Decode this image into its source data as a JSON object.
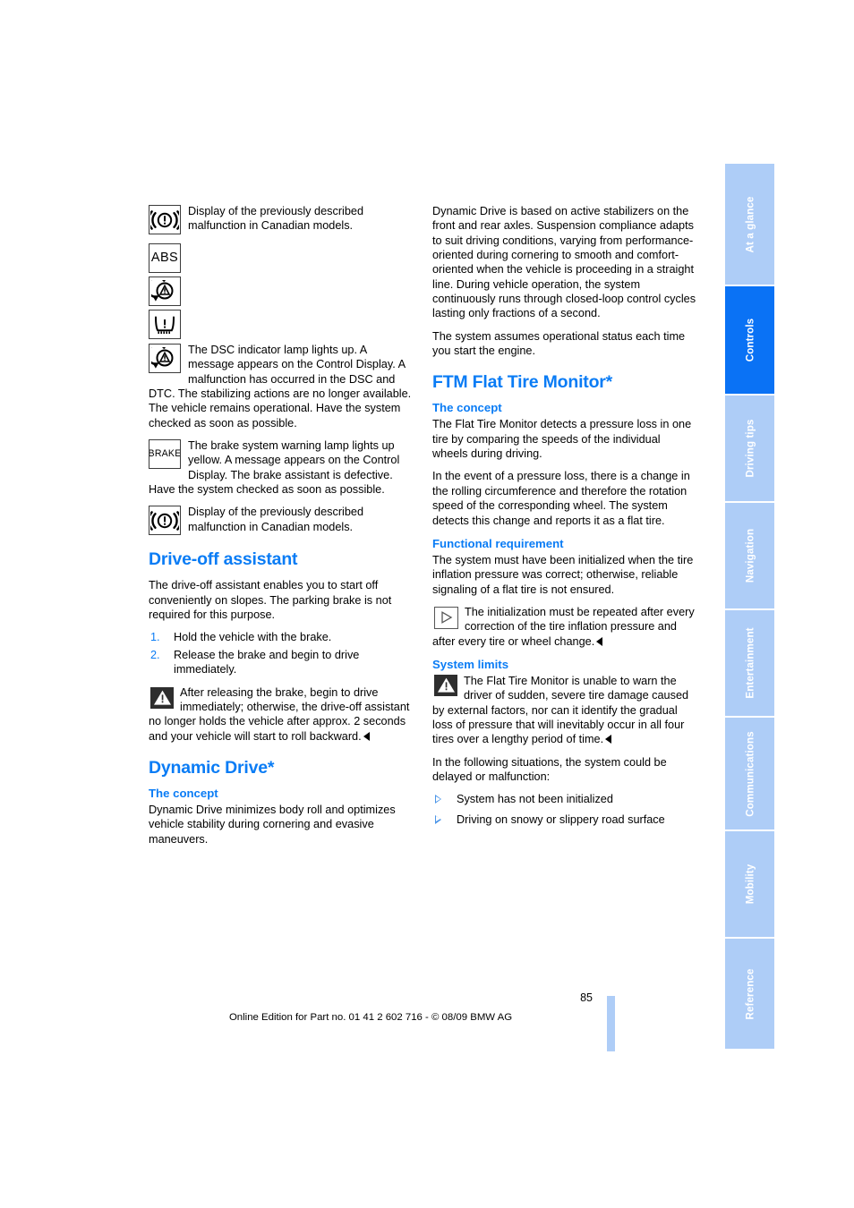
{
  "page": {
    "number": "85",
    "footer_text": "Online Edition for Part no. 01 41 2 602 716 - © 08/09 BMW AG",
    "accent_blue": "#0a7cf5",
    "tab_blue": "#aecdf7",
    "tab_active_blue": "#0a72f5"
  },
  "tabs": [
    {
      "label": "At a glance",
      "active": false
    },
    {
      "label": "Controls",
      "active": true
    },
    {
      "label": "Driving tips",
      "active": false
    },
    {
      "label": "Navigation",
      "active": false
    },
    {
      "label": "Entertainment",
      "active": false
    },
    {
      "label": "Communications",
      "active": false
    },
    {
      "label": "Mobility",
      "active": false
    },
    {
      "label": "Reference",
      "active": false
    }
  ],
  "left_column": {
    "canadian_display_top": "Display of the previously described malfunction in Canadian models.",
    "symbol_labels": {
      "brake_circle": "brake-warning-symbol",
      "abs": "ABS",
      "dsc": "dsc-symbol",
      "tire_pressure": "tire-pressure-symbol",
      "brake_word": "BRAKE"
    },
    "dsc_paragraph": "The DSC indicator lamp lights up. A message appears on the Control Display. A malfunction has occurred in the DSC and DTC. The stabilizing actions are no longer available. The vehicle remains operational. Have the system checked as soon as possible.",
    "brake_paragraph": "The brake system warning lamp lights up yellow. A message appears on the Control Display. The brake assistant is defective. Have the system checked as soon as possible.",
    "canadian_display_bottom": "Display of the previously described malfunction in Canadian models.",
    "drive_off": {
      "heading": "Drive-off assistant",
      "intro": "The drive-off assistant enables you to start off conveniently on slopes. The parking brake is not required for this purpose.",
      "steps": [
        {
          "num": "1.",
          "text": "Hold the vehicle with the brake."
        },
        {
          "num": "2.",
          "text": "Release the brake and begin to drive immediately."
        }
      ],
      "warning": "After releasing the brake, begin to drive immediately; otherwise, the drive-off assistant no longer holds the vehicle after approx. 2 seconds and your vehicle will start to roll backward."
    },
    "dynamic_drive": {
      "heading": "Dynamic Drive*",
      "subheading": "The concept",
      "body": "Dynamic Drive minimizes body roll and optimizes vehicle stability during cornering and evasive maneuvers."
    }
  },
  "right_column": {
    "dynamic_drive_cont_1": "Dynamic Drive is based on active stabilizers on the front and rear axles. Suspension compliance adapts to suit driving conditions, varying from performance-oriented during cornering to smooth and comfort-oriented when the vehicle is proceeding in a straight line. During vehicle operation, the system continuously runs through closed-loop control cycles lasting only fractions of a second.",
    "dynamic_drive_cont_2": "The system assumes operational status each time you start the engine.",
    "ftm": {
      "heading": "FTM Flat Tire Monitor*",
      "concept_heading": "The concept",
      "concept_p1": "The Flat Tire Monitor detects a pressure loss in one tire by comparing the speeds of the individual wheels during driving.",
      "concept_p2": "In the event of a pressure loss, there is a change in the rolling circumference and therefore the rotation speed of the corresponding wheel. The system detects this change and reports it as a flat tire.",
      "functional_heading": "Functional requirement",
      "functional_p1": "The system must have been initialized when the tire inflation pressure was correct; otherwise, reliable signaling of a flat tire is not ensured.",
      "functional_note": "The initialization must be repeated after every correction of the tire inflation pressure and after every tire or wheel change.",
      "limits_heading": "System limits",
      "limits_warning": "The Flat Tire Monitor is unable to warn the driver of sudden, severe tire damage caused by external factors, nor can it identify the gradual loss of pressure that will inevitably occur in all four tires over a lengthy period of time.",
      "limits_intro": "In the following situations, the system could be delayed or malfunction:",
      "limits_items": [
        "System has not been initialized",
        "Driving on snowy or slippery road surface"
      ]
    }
  }
}
